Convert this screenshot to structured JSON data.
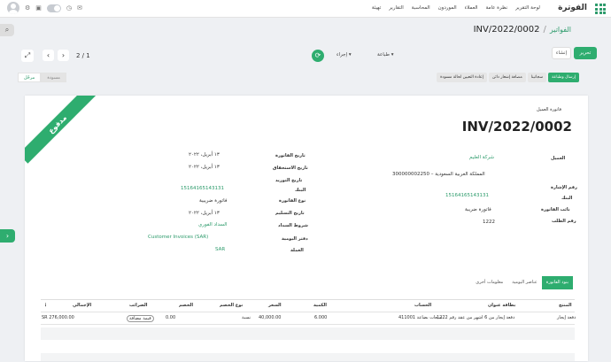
{
  "topbar": {
    "brand": "الفوترة",
    "nav": [
      "لوحة التقرير",
      "نظرة عامة",
      "العملاء",
      "الموردون",
      "المحاسبة",
      "التقارير",
      "تهيئة"
    ]
  },
  "breadcrumb": {
    "parent": "الفواتير",
    "separator": "/",
    "current": "INV/2022/0002"
  },
  "control": {
    "edit": "تحرير",
    "create": "إنشاء",
    "print": "طباعة",
    "action": "إجراء",
    "pager": "2 / 1"
  },
  "actions": [
    "إرسال وطباعة",
    "سجاتينا",
    "مصافة إشعار دائن",
    "إعادة التعيين لحالة مسودة"
  ],
  "statusbar": {
    "draft": "مسودة",
    "posted": "مرحّل"
  },
  "document": {
    "ribbon": "مدفوع",
    "type": "فاتورة العميل",
    "number": "INV/2022/0002"
  },
  "left_fields": [
    {
      "label": "العميل",
      "value": "شركة العليم"
    },
    {
      "label": "",
      "value": "المملكة العربية السعودية – 300000002250"
    },
    {
      "label": "رقم الإشارة",
      "value": "15164165143131"
    },
    {
      "label": "البنك",
      "value": "فاتورة ضريبة"
    },
    {
      "label": "نائب الفاتورة",
      "value": "1222"
    },
    {
      "label": "رقم الطلب",
      "value": ""
    }
  ],
  "right_fields": [
    {
      "label": "تاريخ الفاتورة",
      "value": "١٣ أبريل، ٢٠٢٢"
    },
    {
      "label": "تاريخ الاستحقاق",
      "value": "١٣ أبريل، ٢٠٢٢"
    },
    {
      "label": "تاريخ التوريد",
      "value": ""
    },
    {
      "label": "البنك",
      "value": "15164165143131"
    },
    {
      "label": "نوع الفاتورة",
      "value": "فاتورة ضريبية"
    },
    {
      "label": "تاريخ التسليم",
      "value": "١٣ أبريل، ٢٠٢٢"
    },
    {
      "label": "شروط السداد",
      "value": "السداد الفوري"
    },
    {
      "label": "دفتر اليومية",
      "value": "Customer Invoices (SAR)"
    },
    {
      "label": "العملة",
      "value": "SAR"
    }
  ],
  "tabs": [
    "بنود الفاتورة",
    "عناصر اليومية",
    "معلومات أخرى"
  ],
  "table": {
    "headers": [
      "المنتج",
      "بطاقة عنوان",
      "الحساب",
      "الكمية",
      "السعر",
      "نوع الخصم",
      "الخصم",
      "الضرائب",
      "الإجمالي"
    ],
    "rows": [
      [
        "دفعة إيجار",
        "دفعة إيجار من 6 اشهر من عقد رقم 1222",
        "411001 مبيعات بضاعة",
        "6.000",
        "40,000.00",
        "نسبة",
        "0.00",
        "قيمة مضافة",
        "SR 276,000.00"
      ]
    ]
  },
  "colors": {
    "accent": "#2ead6f"
  }
}
